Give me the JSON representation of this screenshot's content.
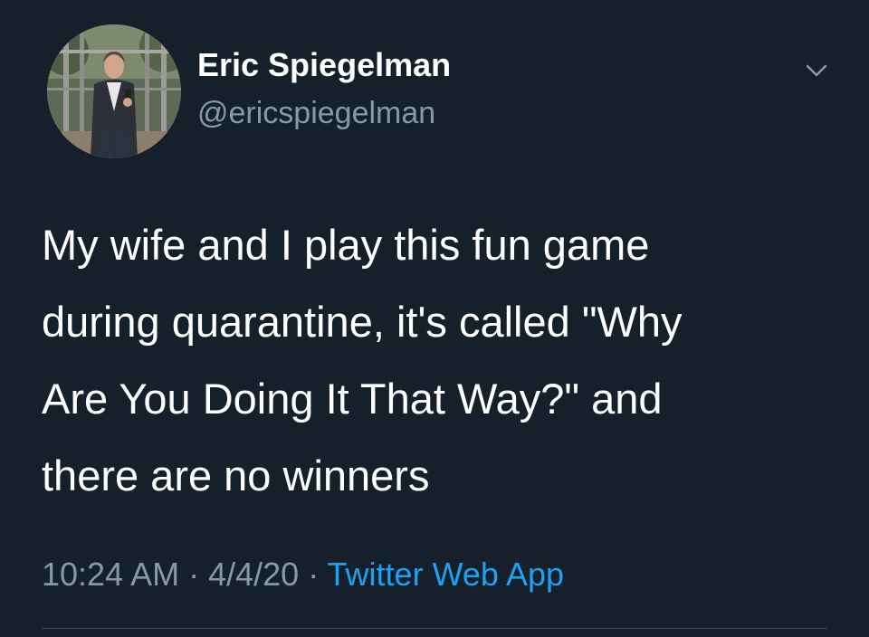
{
  "author": {
    "display_name": "Eric Spiegelman",
    "handle": "@ericspiegelman",
    "avatar_icon": "profile-photo"
  },
  "menu_icon": "chevron-down-icon",
  "tweet": {
    "text_lines": [
      "My wife and I play this fun game",
      "during quarantine, it's called \"Why",
      "Are You Doing It That Way?\" and",
      "there are no winners"
    ]
  },
  "meta": {
    "time": "10:24 AM",
    "separator": " · ",
    "date": "4/4/20",
    "source": "Twitter Web App"
  },
  "colors": {
    "background": "#15202b",
    "primary_text": "#ffffff",
    "secondary_text": "#8899a6",
    "link": "#1da1f2",
    "divider": "#38444d"
  }
}
